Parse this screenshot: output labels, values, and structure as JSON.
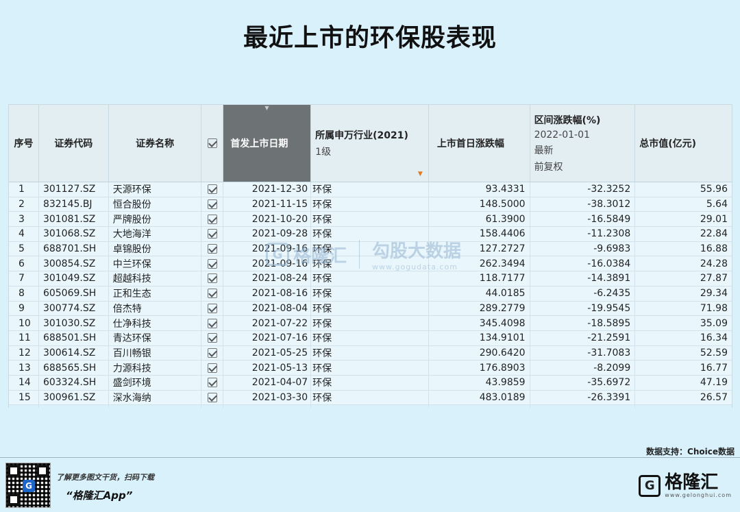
{
  "title": "最近上市的环保股表现",
  "table": {
    "headers": {
      "seq": "序号",
      "code": "证券代码",
      "name": "证券名称",
      "ipo_date": "首发上市日期",
      "industry": "所属申万行业(2021)",
      "industry_sub": "1级",
      "first_day": "上市首日涨跌幅",
      "range_change": "区间涨跌幅(%)",
      "range_date": "2022-01-01",
      "range_latest": "最新",
      "range_adj": "前复权",
      "market_cap": "总市值(亿元)"
    },
    "rows": [
      {
        "seq": "1",
        "code": "301127.SZ",
        "name": "天源环保",
        "date": "2021-12-30",
        "industry": "环保",
        "first_day": "93.4331",
        "change": "-32.3252",
        "cap": "55.96"
      },
      {
        "seq": "2",
        "code": "832145.BJ",
        "name": "恒合股份",
        "date": "2021-11-15",
        "industry": "环保",
        "first_day": "148.5000",
        "change": "-38.3012",
        "cap": "5.64"
      },
      {
        "seq": "3",
        "code": "301081.SZ",
        "name": "严牌股份",
        "date": "2021-10-20",
        "industry": "环保",
        "first_day": "61.3900",
        "change": "-16.5849",
        "cap": "29.01"
      },
      {
        "seq": "4",
        "code": "301068.SZ",
        "name": "大地海洋",
        "date": "2021-09-28",
        "industry": "环保",
        "first_day": "158.4406",
        "change": "-11.2308",
        "cap": "22.84"
      },
      {
        "seq": "5",
        "code": "688701.SH",
        "name": "卓锦股份",
        "date": "2021-09-16",
        "industry": "环保",
        "first_day": "127.2727",
        "change": "-9.6983",
        "cap": "16.88"
      },
      {
        "seq": "6",
        "code": "300854.SZ",
        "name": "中兰环保",
        "date": "2021-09-16",
        "industry": "环保",
        "first_day": "262.3494",
        "change": "-16.0384",
        "cap": "24.28"
      },
      {
        "seq": "7",
        "code": "301049.SZ",
        "name": "超越科技",
        "date": "2021-08-24",
        "industry": "环保",
        "first_day": "118.7177",
        "change": "-14.3891",
        "cap": "27.87"
      },
      {
        "seq": "8",
        "code": "605069.SH",
        "name": "正和生态",
        "date": "2021-08-16",
        "industry": "环保",
        "first_day": "44.0185",
        "change": "-6.2435",
        "cap": "29.34"
      },
      {
        "seq": "9",
        "code": "300774.SZ",
        "name": "倍杰特",
        "date": "2021-08-04",
        "industry": "环保",
        "first_day": "289.2779",
        "change": "-19.9545",
        "cap": "71.98"
      },
      {
        "seq": "10",
        "code": "301030.SZ",
        "name": "仕净科技",
        "date": "2021-07-22",
        "industry": "环保",
        "first_day": "345.4098",
        "change": "-18.5895",
        "cap": "35.09"
      },
      {
        "seq": "11",
        "code": "688501.SH",
        "name": "青达环保",
        "date": "2021-07-16",
        "industry": "环保",
        "first_day": "134.9101",
        "change": "-21.2591",
        "cap": "16.34"
      },
      {
        "seq": "12",
        "code": "300614.SZ",
        "name": "百川畅银",
        "date": "2021-05-25",
        "industry": "环保",
        "first_day": "290.6420",
        "change": "-31.7083",
        "cap": "52.59"
      },
      {
        "seq": "13",
        "code": "688565.SH",
        "name": "力源科技",
        "date": "2021-05-13",
        "industry": "环保",
        "first_day": "176.8903",
        "change": "-8.2099",
        "cap": "16.77"
      },
      {
        "seq": "14",
        "code": "603324.SH",
        "name": "盛剑环境",
        "date": "2021-04-07",
        "industry": "环保",
        "first_day": "43.9859",
        "change": "-35.6972",
        "cap": "47.19"
      },
      {
        "seq": "15",
        "code": "300961.SZ",
        "name": "深水海纳",
        "date": "2021-03-30",
        "industry": "环保",
        "first_day": "483.0189",
        "change": "-26.3391",
        "cap": "26.57"
      }
    ]
  },
  "watermark": {
    "brand": "格隆汇",
    "name": "勾股大数据",
    "url": "www.gogudata.com"
  },
  "source": "数据支持：Choice数据",
  "footer": {
    "promo_line": "了解更多图文干货，扫码下载",
    "app_name": "“格隆汇App”",
    "brand_name": "格隆汇",
    "brand_url": "www.gelonghui.com"
  },
  "colors": {
    "background": "#d9f1fb",
    "sorted_header": "#6d7275",
    "filter_icon": "#e07a1f"
  }
}
